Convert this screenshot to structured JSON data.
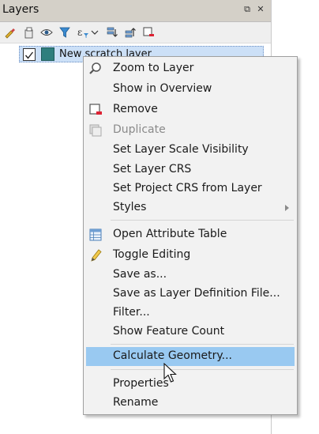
{
  "panel": {
    "title": "Layers",
    "float_glyph": "⧉",
    "close_glyph": "✕"
  },
  "layer": {
    "name": "New scratch layer",
    "checked": true,
    "swatch_color": "#2f7f7e"
  },
  "menu": {
    "items": [
      {
        "label": "Zoom to Layer",
        "icon": "zoom-icon"
      },
      {
        "label": "Show in Overview"
      },
      {
        "label": "Remove",
        "icon": "remove-layer-icon"
      },
      {
        "label": "Duplicate",
        "icon": "duplicate-layer-icon",
        "disabled": true
      },
      {
        "label": "Set Layer Scale Visibility"
      },
      {
        "label": "Set Layer CRS"
      },
      {
        "label": "Set Project CRS from Layer"
      },
      {
        "label": "Styles",
        "submenu": true
      },
      {
        "label": "Open Attribute Table",
        "icon": "attribute-table-icon"
      },
      {
        "label": "Toggle Editing",
        "icon": "pencil-icon"
      },
      {
        "label": "Save as..."
      },
      {
        "label": "Save as Layer Definition File..."
      },
      {
        "label": "Filter..."
      },
      {
        "label": "Show Feature Count"
      },
      {
        "label": "Calculate Geometry...",
        "highlighted": true
      },
      {
        "label": "Properties"
      },
      {
        "label": "Rename"
      }
    ]
  },
  "colors": {
    "highlight": "#99c9f1",
    "menu_bg": "#f2f2f2"
  }
}
